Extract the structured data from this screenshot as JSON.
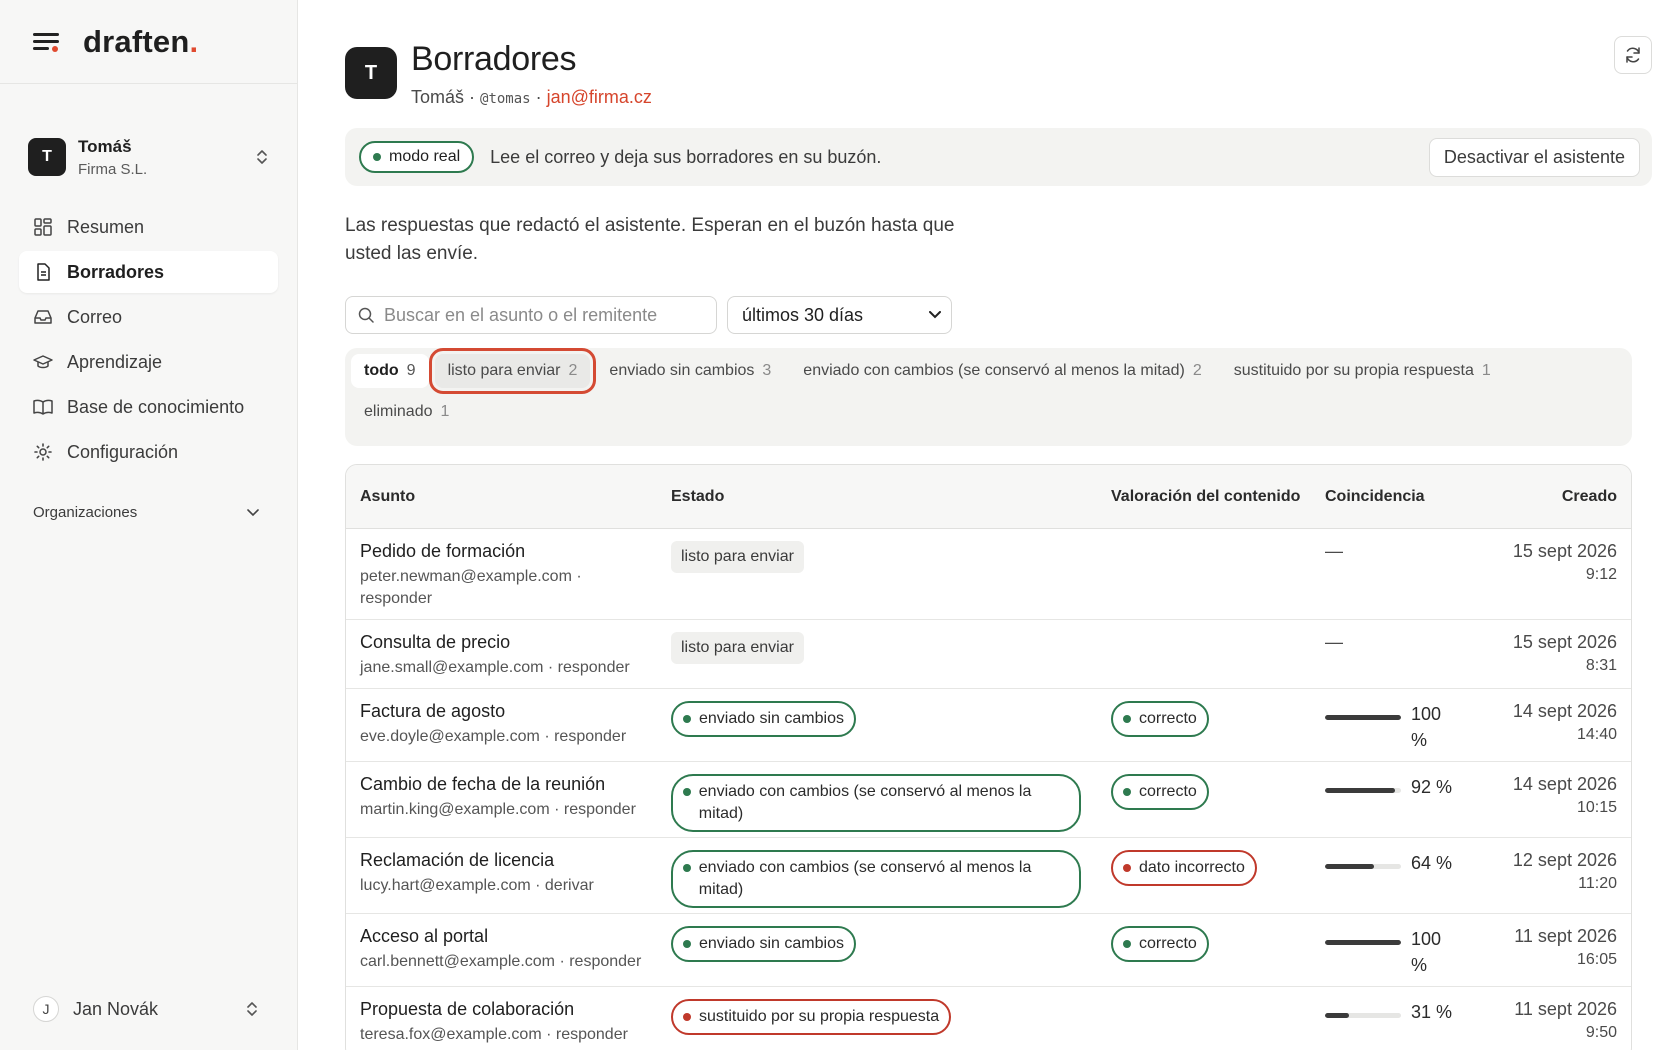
{
  "brand": {
    "name": "draften",
    "dot": "."
  },
  "account": {
    "initial": "T",
    "name": "Tomáš",
    "org": "Firma S.L."
  },
  "nav": [
    {
      "label": "Resumen",
      "icon": "dashboard-icon"
    },
    {
      "label": "Borradores",
      "icon": "document-icon",
      "active": true
    },
    {
      "label": "Correo",
      "icon": "inbox-icon"
    },
    {
      "label": "Aprendizaje",
      "icon": "graduation-cap-icon"
    },
    {
      "label": "Base de conocimiento",
      "icon": "book-icon"
    },
    {
      "label": "Configuración",
      "icon": "gear-icon"
    }
  ],
  "orgs_label": "Organizaciones",
  "user": {
    "initial": "J",
    "name": "Jan Novák"
  },
  "header": {
    "initial": "T",
    "title": "Borradores",
    "name": "Tomáš",
    "sep": " · ",
    "handle": "@tomas",
    "email": "jan@firma.cz"
  },
  "banner": {
    "mode": "modo real",
    "message": "Lee el correo y deja sus borradores en su buzón.",
    "deactivate": "Desactivar el asistente"
  },
  "intro": "Las respuestas que redactó el asistente. Esperan en el buzón hasta que usted las envíe.",
  "search": {
    "placeholder": "Buscar en el asunto o el remitente",
    "value": ""
  },
  "period": {
    "selected": "últimos 30 días"
  },
  "tabs": [
    {
      "label": "todo",
      "count": "9"
    },
    {
      "label": "listo para enviar",
      "count": "2"
    },
    {
      "label": "enviado sin cambios",
      "count": "3"
    },
    {
      "label": "enviado con cambios (se conservó al menos la mitad)",
      "count": "2"
    },
    {
      "label": "sustituido por su propia respuesta",
      "count": "1"
    },
    {
      "label": "eliminado",
      "count": "1"
    }
  ],
  "columns": {
    "subject": "Asunto",
    "status": "Estado",
    "rating": "Valoración del contenido",
    "match": "Coincidencia",
    "created": "Creado"
  },
  "rows": [
    {
      "subject": "Pedido de formación",
      "from": "peter.newman@example.com · responder",
      "status": "listo para enviar",
      "rating": "",
      "match": "—",
      "date": "15 sept 2026",
      "time": "9:12"
    },
    {
      "subject": "Consulta de precio",
      "from": "jane.small@example.com · responder",
      "status": "listo para enviar",
      "rating": "",
      "match": "—",
      "date": "15 sept 2026",
      "time": "8:31"
    },
    {
      "subject": "Factura de agosto",
      "from": "eve.doyle@example.com · responder",
      "status": "enviado sin cambios",
      "rating": "correcto",
      "match_pct": "100 %",
      "match_value": 100,
      "date": "14 sept 2026",
      "time": "14:40"
    },
    {
      "subject": "Cambio de fecha de la reunión",
      "from": "martin.king@example.com · responder",
      "status": "enviado con cambios (se conservó al menos la mitad)",
      "rating": "correcto",
      "match_pct": "92 %",
      "match_value": 92,
      "date": "14 sept 2026",
      "time": "10:15"
    },
    {
      "subject": "Reclamación de licencia",
      "from": "lucy.hart@example.com · derivar",
      "status": "enviado con cambios (se conservó al menos la mitad)",
      "rating": "dato incorrecto",
      "match_pct": "64 %",
      "match_value": 64,
      "date": "12 sept 2026",
      "time": "11:20"
    },
    {
      "subject": "Acceso al portal",
      "from": "carl.bennett@example.com · responder",
      "status": "enviado sin cambios",
      "rating": "correcto",
      "match_pct": "100 %",
      "match_value": 100,
      "date": "11 sept 2026",
      "time": "16:05"
    },
    {
      "subject": "Propuesta de colaboración",
      "from": "teresa.fox@example.com · responder",
      "status": "sustituido por su propia respuesta",
      "rating": "",
      "match_pct": "31 %",
      "match_value": 31,
      "date": "11 sept 2026",
      "time": "9:50"
    }
  ],
  "colors": {
    "accent": "#e04a2f",
    "green": "#2e7a4f",
    "red": "#c0392b"
  }
}
